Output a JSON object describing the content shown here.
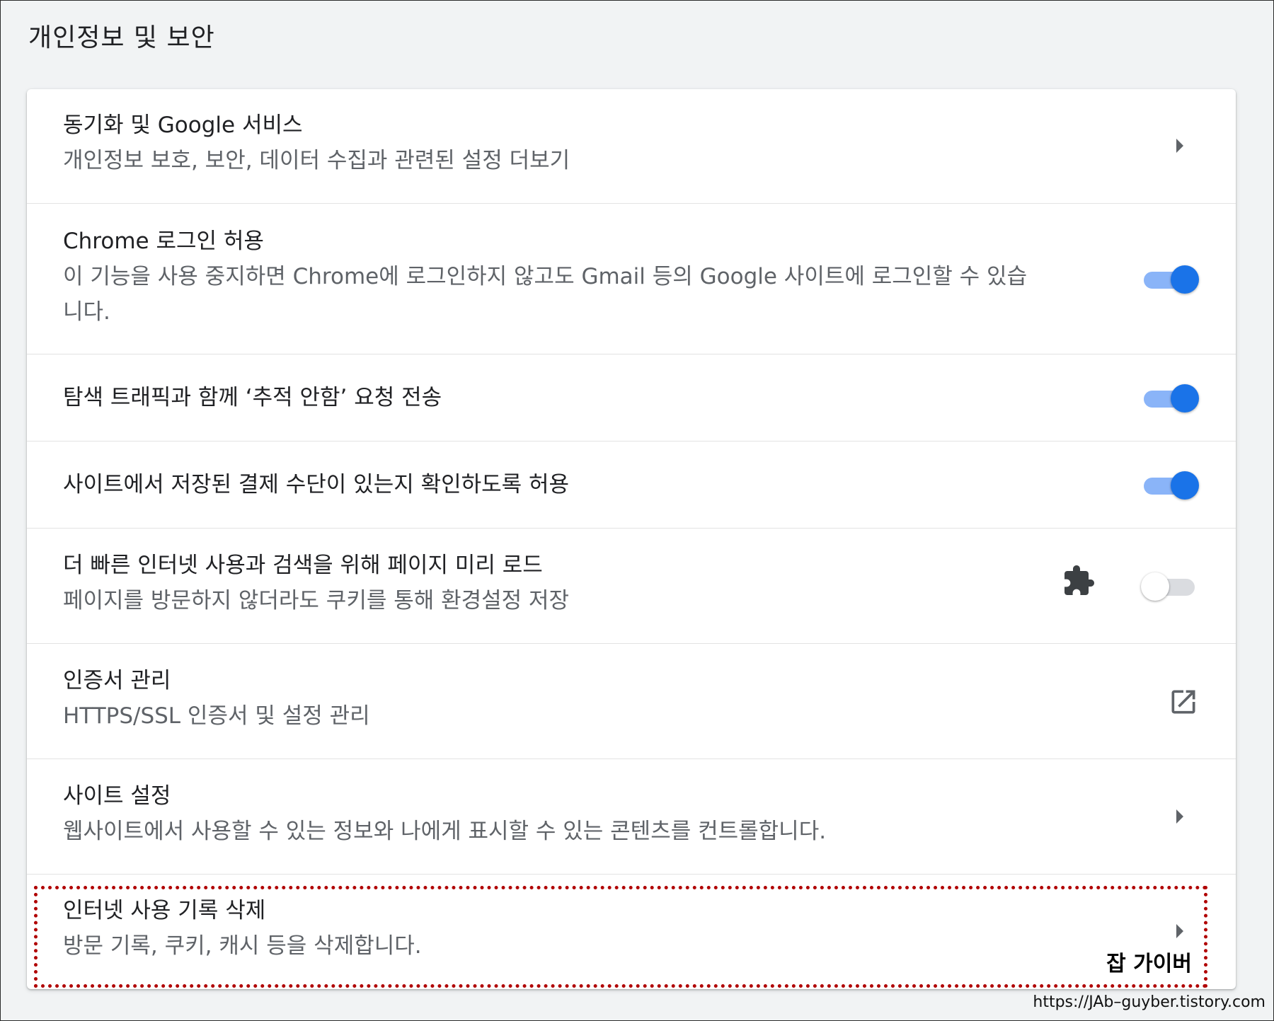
{
  "section": {
    "title": "개인정보 및 보안"
  },
  "rows": [
    {
      "label": "동기화 및 Google 서비스",
      "sub": "개인정보 보호, 보안, 데이터 수집과 관련된 설정 더보기",
      "control": "chevron-right-icon"
    },
    {
      "label": "Chrome 로그인 허용",
      "sub_line1": "이 기능을 사용 중지하면 Chrome에 로그인하지 않고도 Gmail 등의 Google 사이트에 로그인할 수 있습",
      "sub_line2": "니다.",
      "control": "toggle",
      "toggle_on": true
    },
    {
      "label": "탐색 트래픽과 함께 ‘추적 안함’ 요청 전송",
      "control": "toggle",
      "toggle_on": true
    },
    {
      "label": "사이트에서 저장된 결제 수단이 있는지 확인하도록 허용",
      "control": "toggle",
      "toggle_on": true
    },
    {
      "label": "더 빠른 인터넷 사용과 검색을 위해 페이지 미리 로드",
      "sub": "페이지를 방문하지 않더라도 쿠키를 통해 환경설정 저장",
      "control": "toggle",
      "toggle_on": false,
      "extra_icon": "extension-puzzle-icon"
    },
    {
      "label": "인증서 관리",
      "sub": "HTTPS/SSL 인증서 및 설정 관리",
      "control": "open-in-new-icon"
    },
    {
      "label": "사이트 설정",
      "sub": "웹사이트에서 사용할 수 있는 정보와 나에게 표시할 수 있는 콘텐츠를 컨트롤합니다.",
      "control": "chevron-right-icon"
    },
    {
      "label": "인터넷 사용 기록 삭제",
      "sub": "방문 기록, 쿠키, 캐시 등을 삭제합니다.",
      "control": "chevron-right-icon"
    }
  ],
  "overlay": {
    "watermark": "잡 가이버",
    "url_caption": "https://JAb–guyber.tistory.com",
    "highlight_color": "#b00000"
  },
  "colors": {
    "toggle_track_on": "#8ab4f8",
    "toggle_knob_on": "#1a73e8",
    "toggle_track_off": "#dadce0",
    "secondary_text": "#5f6368",
    "primary_text": "#202124",
    "page_background": "#f1f3f4"
  }
}
